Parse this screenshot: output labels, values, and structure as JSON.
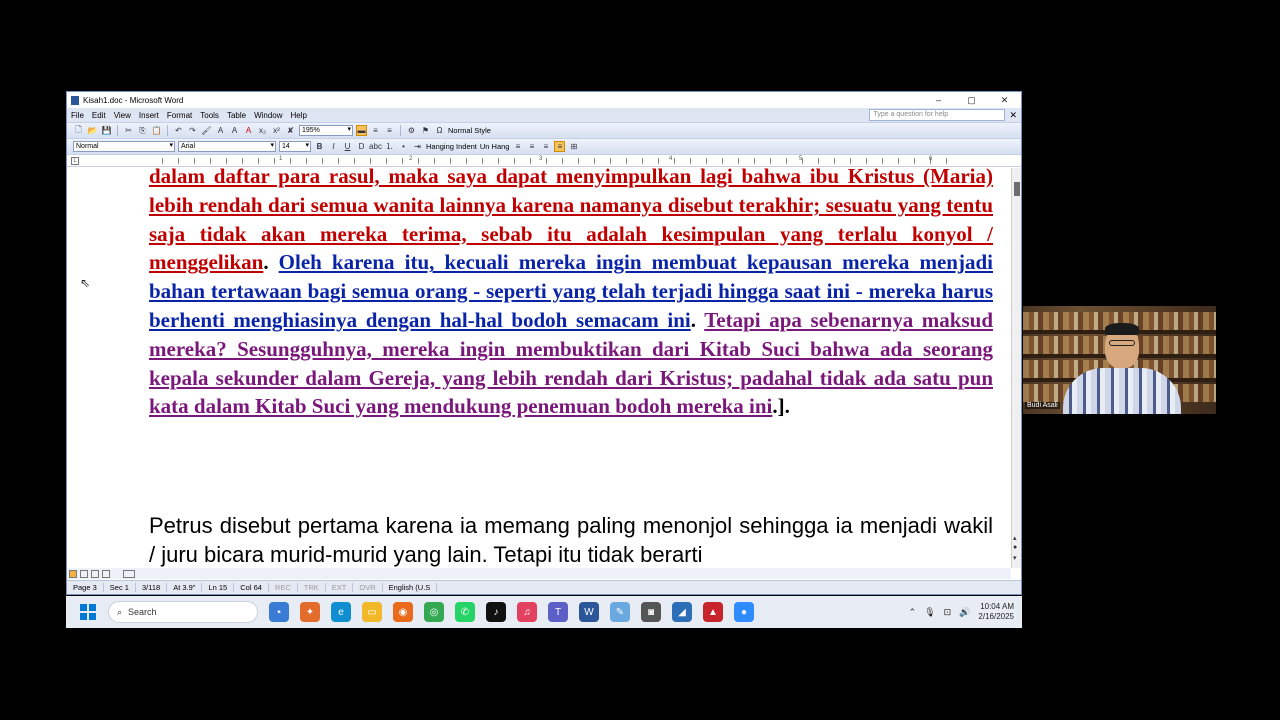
{
  "window": {
    "title": "Kisah1.doc - Microsoft Word",
    "controls": [
      "–",
      "▢",
      "✕"
    ]
  },
  "menu": {
    "items": [
      "File",
      "Edit",
      "View",
      "Insert",
      "Format",
      "Tools",
      "Table",
      "Window",
      "Help"
    ],
    "help_placeholder": "Type a question for help"
  },
  "toolbar1": {
    "zoom": "195%",
    "style_label": "Normal Style"
  },
  "toolbar2": {
    "style": "Normal",
    "font": "Arial",
    "size": "14",
    "bold": "B",
    "italic": "I",
    "underline": "U",
    "hanging": "Hanging Indent",
    "unhang": "Un Hang"
  },
  "ruler": {
    "numbers": [
      "1",
      "2",
      "3",
      "4",
      "5",
      "6",
      "7"
    ]
  },
  "document": {
    "para1_red": "dalam daftar para rasul, maka saya dapat menyimpulkan lagi bahwa ibu Kristus (Maria) lebih rendah dari semua wanita lainnya karena namanya disebut terakhir; sesuatu yang tentu saja tidak akan mereka terima, sebab itu adalah kesimpulan yang terlalu konyol / menggelikan",
    "para1_dot1": ". ",
    "para1_blue": "Oleh karena itu, kecuali mereka ingin membuat kepausan mereka menjadi bahan tertawaan bagi semua orang - seperti yang telah terjadi hingga saat ini - mereka harus berhenti menghiasinya dengan hal-hal bodoh semacam ini",
    "para1_dot2": ". ",
    "para1_purple": "Tetapi apa sebenarnya maksud mereka? Sesungguhnya, mereka ingin membuktikan dari Kitab Suci bahwa ada seorang kepala sekunder dalam Gereja, yang lebih rendah dari Kristus; padahal tidak ada satu pun kata dalam Kitab Suci yang mendukung penemuan bodoh mereka ini",
    "para1_end": ".].",
    "para2": "Petrus disebut pertama karena ia memang paling menonjol sehingga ia menjadi wakil / juru bicara murid-murid yang lain. Tetapi itu tidak berarti"
  },
  "status": {
    "page": "Page 3",
    "sec": "Sec 1",
    "pages": "3/118",
    "at": "At 3.9\"",
    "ln": "Ln 15",
    "col": "Col 64",
    "rec": "REC",
    "trk": "TRK",
    "ext": "EXT",
    "ovr": "OVR",
    "lang": "English (U.S"
  },
  "taskbar": {
    "search": "Search",
    "time": "10:04 AM",
    "date": "2/16/2025"
  },
  "webcam": {
    "name": "Budi Asali"
  },
  "colors": {
    "red": "#c00000",
    "blue": "#0a24a8",
    "purple": "#7a177a",
    "word_blue": "#2b579a"
  }
}
